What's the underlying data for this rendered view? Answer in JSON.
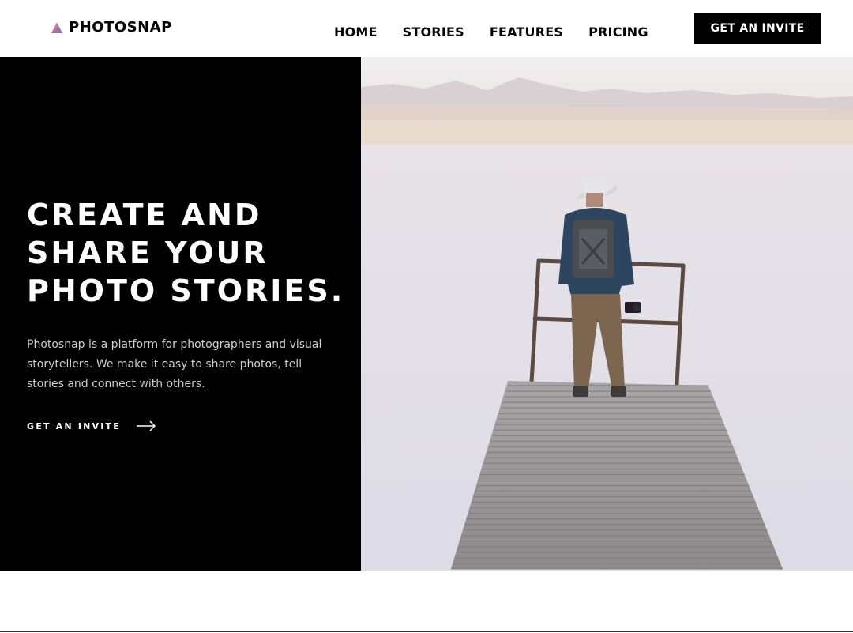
{
  "brand": {
    "name": "PHOTOSNAP",
    "logo_icon": "triangle-gradient-icon"
  },
  "nav": {
    "items": [
      {
        "label": "HOME"
      },
      {
        "label": "STORIES"
      },
      {
        "label": "FEATURES"
      },
      {
        "label": "PRICING"
      }
    ],
    "cta_label": "GET AN INVITE"
  },
  "hero": {
    "title_lines": [
      "CREATE AND",
      "SHARE YOUR",
      "PHOTO STORIES."
    ],
    "description": "Photosnap is a platform for photographers and visual storytellers. We make it easy to share photos, tell stories and connect with others.",
    "link_label": "GET AN INVITE",
    "link_icon": "arrow-right-icon"
  },
  "colors": {
    "accent": "#000000",
    "background": "#ffffff",
    "body_text": "#cfcfcf",
    "logo_gradient": [
      "#FFC593",
      "#BC7198",
      "#5A77FF"
    ]
  }
}
